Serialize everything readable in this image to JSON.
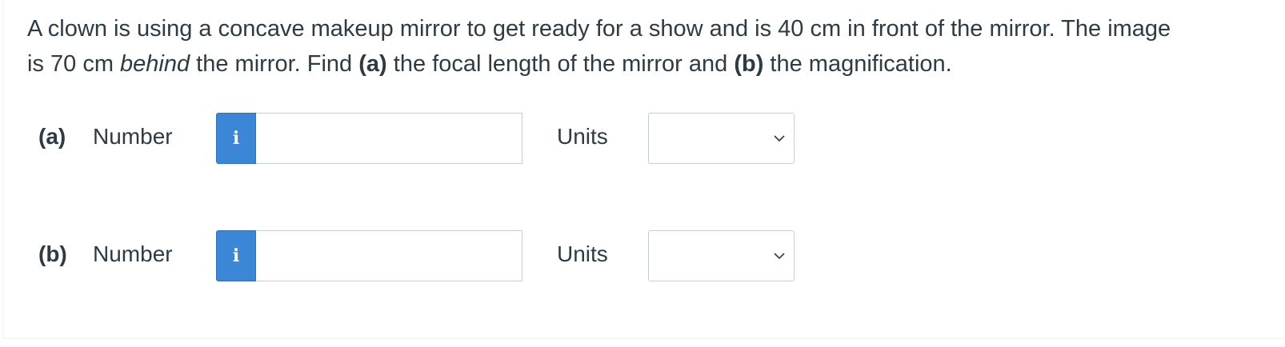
{
  "question": {
    "line1": "A clown is using a concave makeup mirror to get ready for a show and is 40 cm in front of the mirror. The image",
    "seg_a": "is 70 cm ",
    "seg_behind": "behind",
    "seg_b": " the mirror. Find ",
    "seg_part_a": "(a)",
    "seg_c": " the focal length of the mirror and ",
    "seg_part_b": "(b)",
    "seg_d": " the magnification."
  },
  "parts": [
    {
      "label": "(a)",
      "number_label": "Number",
      "info_icon": "i",
      "number_value": "",
      "units_label": "Units",
      "units_value": ""
    },
    {
      "label": "(b)",
      "number_label": "Number",
      "info_icon": "i",
      "number_value": "",
      "units_label": "Units",
      "units_value": ""
    }
  ],
  "colors": {
    "text": "#2d3b45",
    "info_button": "#3b86d6",
    "input_border": "#c7cdd1"
  },
  "icons": {
    "info": "info-icon",
    "dropdown": "chevron-down-icon"
  }
}
